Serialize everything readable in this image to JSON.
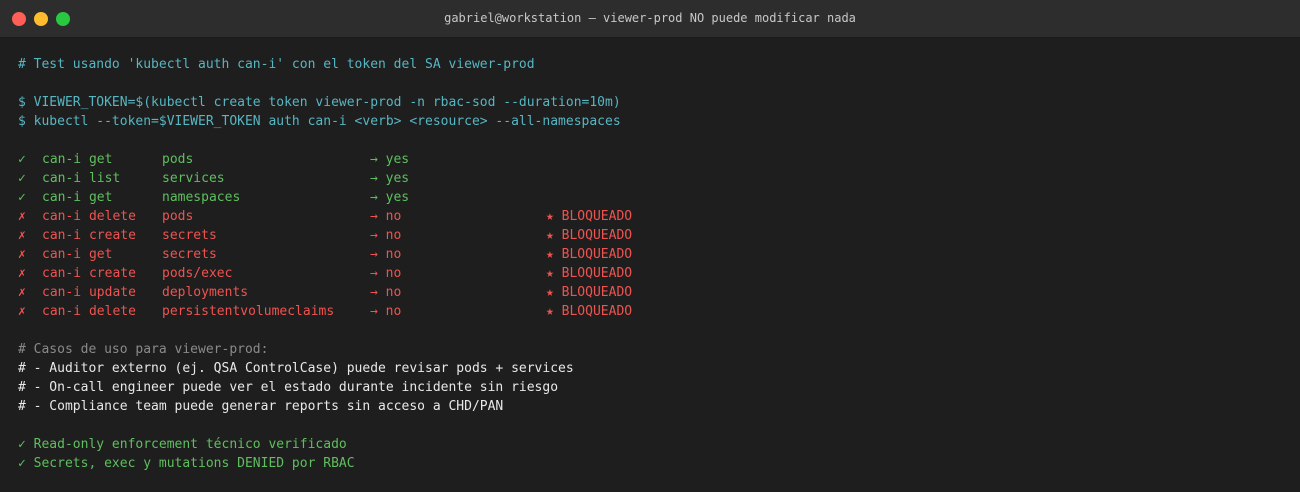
{
  "window": {
    "title": "gabriel@workstation — viewer-prod NO puede modificar nada"
  },
  "terminal": {
    "comment_header": "# Test usando 'kubectl auth can-i' con el token del SA viewer-prod",
    "commands": [
      "$ VIEWER_TOKEN=$(kubectl create token viewer-prod -n rbac-sod --duration=10m)",
      "$ kubectl --token=$VIEWER_TOKEN auth can-i <verb> <resource> --all-namespaces"
    ],
    "checks": [
      {
        "mark": "✓",
        "verb": "can-i get",
        "resource": "pods",
        "result": "→ yes",
        "flag": "",
        "status": "allowed"
      },
      {
        "mark": "✓",
        "verb": "can-i list",
        "resource": "services",
        "result": "→ yes",
        "flag": "",
        "status": "allowed"
      },
      {
        "mark": "✓",
        "verb": "can-i get",
        "resource": "namespaces",
        "result": "→ yes",
        "flag": "",
        "status": "allowed"
      },
      {
        "mark": "✗",
        "verb": "can-i delete",
        "resource": "pods",
        "result": "→ no",
        "flag": "★ BLOQUEADO",
        "status": "denied"
      },
      {
        "mark": "✗",
        "verb": "can-i create",
        "resource": "secrets",
        "result": "→ no",
        "flag": "★ BLOQUEADO",
        "status": "denied"
      },
      {
        "mark": "✗",
        "verb": "can-i get",
        "resource": "secrets",
        "result": "→ no",
        "flag": "★ BLOQUEADO",
        "status": "denied"
      },
      {
        "mark": "✗",
        "verb": "can-i create",
        "resource": "pods/exec",
        "result": "→ no",
        "flag": "★ BLOQUEADO",
        "status": "denied"
      },
      {
        "mark": "✗",
        "verb": "can-i update",
        "resource": "deployments",
        "result": "→ no",
        "flag": "★ BLOQUEADO",
        "status": "denied"
      },
      {
        "mark": "✗",
        "verb": "can-i delete",
        "resource": "persistentvolumeclaims",
        "result": "→ no",
        "flag": "★ BLOQUEADO",
        "status": "denied"
      }
    ],
    "usecases_header": "# Casos de uso para viewer-prod:",
    "usecases": [
      "# - Auditor externo (ej. QSA ControlCase) puede revisar pods + services",
      "# - On-call engineer puede ver el estado durante incidente sin riesgo",
      "# - Compliance team puede generar reports sin acceso a CHD/PAN"
    ],
    "summary": [
      "✓ Read-only enforcement técnico verificado",
      "✓ Secrets, exec y mutations DENIED por RBAC"
    ]
  },
  "colors": {
    "background": "#1e1e1e",
    "titlebar": "#2d2d2d",
    "comment_cyan": "#56b6c2",
    "allowed_green": "#5fbf5f",
    "denied_red": "#ef5350",
    "muted_grey": "#8a8a8a",
    "text_white": "#e8e8e8"
  }
}
